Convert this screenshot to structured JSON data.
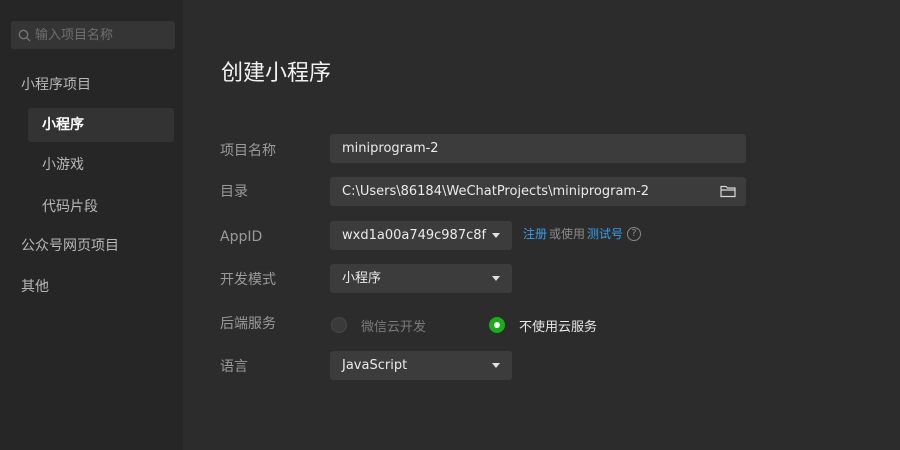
{
  "sidebar": {
    "search": {
      "placeholder": "输入项目名称"
    },
    "items": [
      {
        "label": "小程序项目"
      },
      {
        "label": "小程序"
      },
      {
        "label": "小游戏"
      },
      {
        "label": "代码片段"
      },
      {
        "label": "公众号网页项目"
      },
      {
        "label": "其他"
      }
    ]
  },
  "form": {
    "title": "创建小程序",
    "project_name": {
      "label": "项目名称",
      "value": "miniprogram-2"
    },
    "directory": {
      "label": "目录",
      "value": "C:\\Users\\86184\\WeChatProjects\\miniprogram-2"
    },
    "appid": {
      "label": "AppID",
      "value": "wxd1a00a749c987c8f",
      "register_link": "注册",
      "or_use": "或使用",
      "test_link": "测试号",
      "help": "?"
    },
    "dev_mode": {
      "label": "开发模式",
      "value": "小程序"
    },
    "backend": {
      "label": "后端服务",
      "option_cloud": "微信云开发",
      "option_none": "不使用云服务",
      "selected": "不使用云服务"
    },
    "language": {
      "label": "语言",
      "value": "JavaScript"
    }
  },
  "colors": {
    "accent_green": "#1aad19",
    "link_blue": "#3b9ee8",
    "sidebar_bg": "#262626",
    "main_bg": "#2c2c2c"
  },
  "icons": {
    "search": "search-icon",
    "folder": "folder-icon",
    "dropdown": "chevron-down-icon",
    "help": "help-circle-icon"
  }
}
